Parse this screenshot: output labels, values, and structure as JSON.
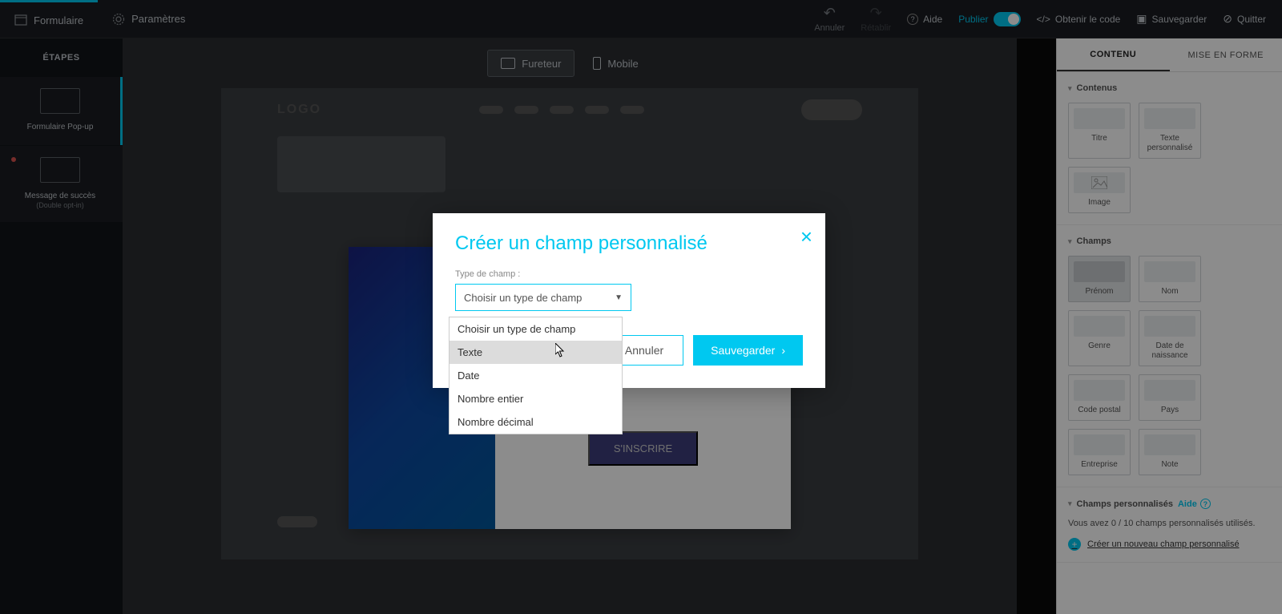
{
  "topbar": {
    "formulaire": "Formulaire",
    "parametres": "Paramètres",
    "annuler": "Annuler",
    "retablir": "Rétablir",
    "aide": "Aide",
    "publier": "Publier",
    "obtenir_code": "Obtenir le code",
    "sauvegarder": "Sauvegarder",
    "quitter": "Quitter"
  },
  "sidebar": {
    "header": "ÉTAPES",
    "items": [
      {
        "label": "Formulaire Pop-up",
        "sublabel": ""
      },
      {
        "label": "Message de succès",
        "sublabel": "(Double opt-in)"
      }
    ]
  },
  "device": {
    "fureteur": "Fureteur",
    "mobile": "Mobile"
  },
  "canvas": {
    "logo": "LOGO",
    "submit": "S'INSCRIRE"
  },
  "right_panel": {
    "tab_contenu": "CONTENU",
    "tab_mise_en_forme": "MISE EN FORME",
    "section_contenus": "Contenus",
    "contenus_items": [
      "Titre",
      "Texte personnalisé",
      "Image"
    ],
    "section_champs": "Champs",
    "champs_items": [
      "Prénom",
      "Nom",
      "Genre",
      "Date de naissance",
      "Code postal",
      "Pays",
      "Entreprise",
      "Note"
    ],
    "section_custom": "Champs personnalisés",
    "aide": "Aide",
    "custom_info": "Vous avez 0 / 10 champs personnalisés utilisés.",
    "custom_link": "Créer un nouveau champ personnalisé"
  },
  "modal": {
    "title": "Créer un champ personnalisé",
    "type_label": "Type de champ :",
    "placeholder": "Choisir un type de champ",
    "btn_cancel": "Annuler",
    "btn_save": "Sauvegarder",
    "options": [
      "Choisir un type de champ",
      "Texte",
      "Date",
      "Nombre entier",
      "Nombre décimal"
    ]
  }
}
